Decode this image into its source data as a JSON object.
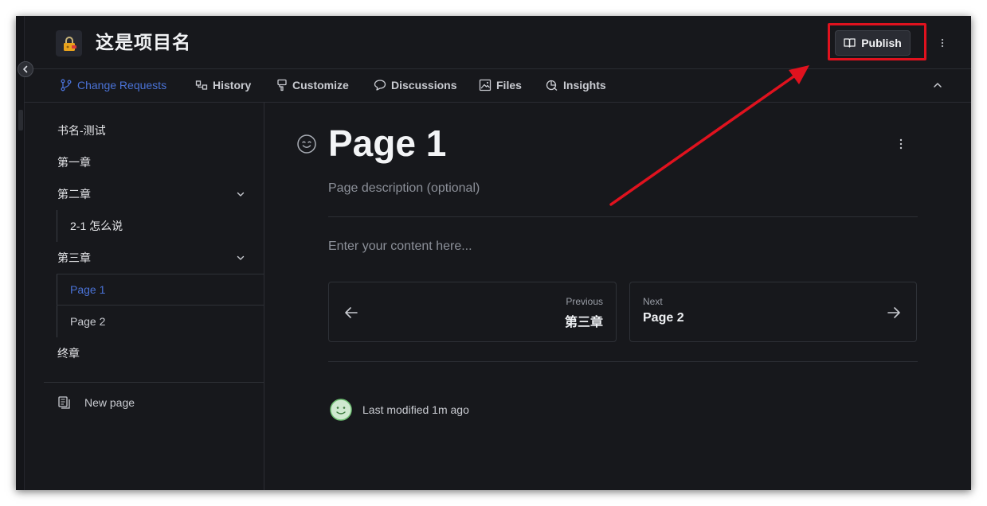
{
  "project": {
    "title": "这是项目名",
    "icon": "lock-icon"
  },
  "header": {
    "publish_label": "Publish",
    "publish_icon": "book-icon",
    "more_icon": "vertical-dots-icon"
  },
  "tabs": [
    {
      "label": "Change Requests",
      "icon": "branch-icon",
      "active": true
    },
    {
      "label": "History",
      "icon": "history-icon"
    },
    {
      "label": "Customize",
      "icon": "paint-icon"
    },
    {
      "label": "Discussions",
      "icon": "chat-icon"
    },
    {
      "label": "Files",
      "icon": "image-icon"
    },
    {
      "label": "Insights",
      "icon": "insights-icon"
    }
  ],
  "sidebar": {
    "items": [
      {
        "label": "书名-测试"
      },
      {
        "label": "第一章"
      },
      {
        "label": "第二章",
        "expanded": true
      },
      {
        "label": "2-1 怎么说"
      },
      {
        "label": "第三章",
        "expanded": true
      },
      {
        "label": "Page 1",
        "active": true
      },
      {
        "label": "Page 2"
      },
      {
        "label": "终章"
      }
    ],
    "new_page_label": "New page"
  },
  "page": {
    "title": "Page 1",
    "description_placeholder": "Page description (optional)",
    "content_placeholder": "Enter your content here...",
    "previous": {
      "small": "Previous",
      "title": "第三章"
    },
    "next": {
      "small": "Next",
      "title": "Page 2"
    },
    "last_modified": "Last modified 1m ago"
  },
  "colors": {
    "accent": "#4a72d6",
    "background": "#17181c",
    "annotation": "#e0121e"
  }
}
